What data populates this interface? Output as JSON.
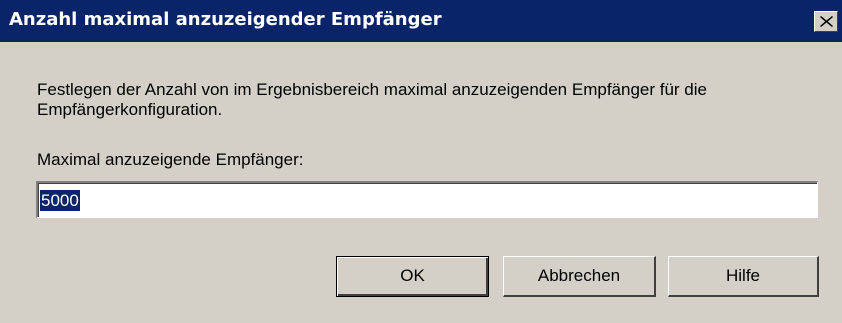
{
  "window": {
    "title": "Anzahl maximal anzuzeigender Empfänger",
    "close_icon": "close-icon"
  },
  "content": {
    "description": "Festlegen der Anzahl von im Ergebnisbereich maximal anzuzeigenden Empfänger für die Empfängerkonfiguration.",
    "field_label": "Maximal anzuzeigende Empfänger:",
    "field_value": "5000"
  },
  "buttons": {
    "ok": "OK",
    "cancel": "Abbrechen",
    "help": "Hilfe"
  },
  "colors": {
    "titlebar": "#0a246a",
    "dialog_background": "#d4d0c8",
    "selection": "#0a246a"
  }
}
